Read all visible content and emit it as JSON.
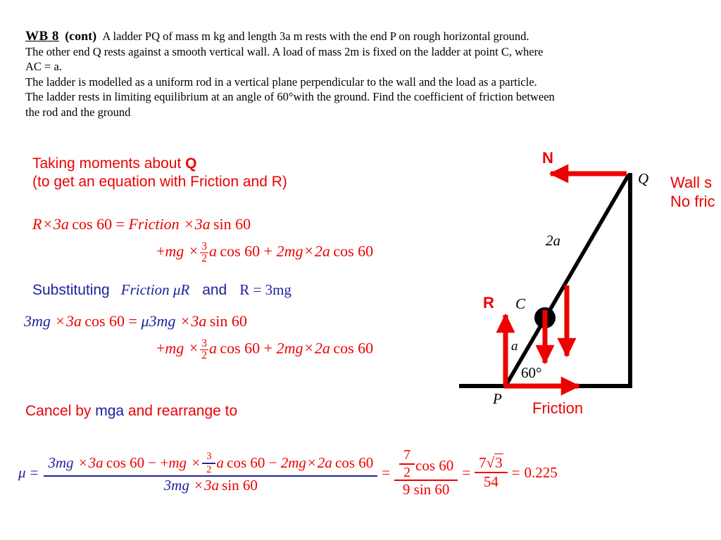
{
  "slide": {
    "title_tag": "WB 8",
    "cont_tag": "(cont)",
    "question_lines": [
      "A ladder PQ of mass m kg and length 3a m rests with the end P on rough horizontal ground.",
      "The other end Q rests against a smooth vertical wall. A load of mass 2m is fixed on the ladder at point C, where",
      "AC = a.",
      "The ladder is modelled as a uniform rod in a vertical plane perpendicular to the wall and the load as a particle.",
      "The ladder rests in limiting equilibrium at an angle of 60°with the ground. Find the coefficient of friction between",
      "the rod and the ground"
    ]
  },
  "working": {
    "moments_line1_a": "Taking moments about ",
    "moments_line1_b": "Q",
    "moments_line2": "(to get an equation with Friction and R)",
    "eq1": {
      "lhs_R": "R",
      "times1": "×",
      "lhs_3a": "3a",
      "cos60_1": "cos 60",
      "equals": "=",
      "friction": "Friction",
      "times2": "×",
      "rhs_3a": "3a",
      "sin60": "sin 60",
      "plus": "+",
      "mg": "mg",
      "times3": "×",
      "frac_num": "3",
      "frac_den": "2",
      "a": "a",
      "cos60_2": "cos 60",
      "plus2": "+",
      "two_mg": "2mg",
      "times4": "×",
      "two_a": "2a",
      "cos60_3": "cos 60"
    },
    "subst": {
      "word": "Substituting",
      "friction_mur": "Friction μR",
      "and": "and",
      "r_eq": "R = 3mg"
    },
    "eq2": {
      "lhs_3mg": "3mg",
      "times1": "×",
      "lhs_3a": "3a",
      "cos60_1": "cos 60",
      "equals": "=",
      "mu3mg": "μ3mg",
      "times2": "×",
      "rhs_3a": "3a",
      "sin60": "sin 60",
      "plus": "+",
      "mg": "mg",
      "times3": "×",
      "frac_num": "3",
      "frac_den": "2",
      "a": "a",
      "cos60_2": "cos 60",
      "plus2": "+",
      "two_mg": "2mg",
      "times4": "×",
      "two_a": "2a",
      "cos60_3": "cos 60"
    },
    "cancel": {
      "part1": "Cancel by ",
      "mga": "mga",
      "part2": " and rearrange to"
    },
    "final": {
      "mu": "μ",
      "equals1": "=",
      "num_3mg": "3mg",
      "num_times1": "×",
      "num_3a": "3a",
      "num_cos60_1": "cos 60",
      "num_minus_plus": "− +",
      "num_mg": "mg",
      "num_times2": "×",
      "num_frac_num": "3",
      "num_frac_den": "2",
      "num_a": "a",
      "num_cos60_2": "cos 60",
      "num_minus2": "−",
      "num_2mg": "2mg",
      "num_times3": "×",
      "num_2a": "2a",
      "num_cos60_3": "cos 60",
      "den_3mg": "3mg",
      "den_times": "×",
      "den_3a": "3a",
      "den_sin60": "sin 60",
      "equals2": "=",
      "f2_num_7": "7",
      "f2_num_2": "2",
      "f2_cos60": "cos 60",
      "f2_den": "9 sin 60",
      "equals3": "=",
      "f3_num_7": "7",
      "f3_root3": "3",
      "f3_den": "54",
      "equals4": "=",
      "answer": "0.225"
    }
  },
  "diagram": {
    "label_N": "N",
    "label_Q": "Q",
    "label_P": "P",
    "label_C": "C",
    "label_R": "R",
    "label_a": "a",
    "label_2a": "2a",
    "label_angle": "60°",
    "label_friction": "Friction",
    "wall_note_line1": "Wall s",
    "wall_note_line2": "No fric",
    "colors": {
      "force_red": "#ee0000",
      "structure_black": "#000000"
    }
  },
  "colors": {
    "red": "#ee0000",
    "blue": "#20209e",
    "black": "#000000",
    "background": "#ffffff"
  }
}
